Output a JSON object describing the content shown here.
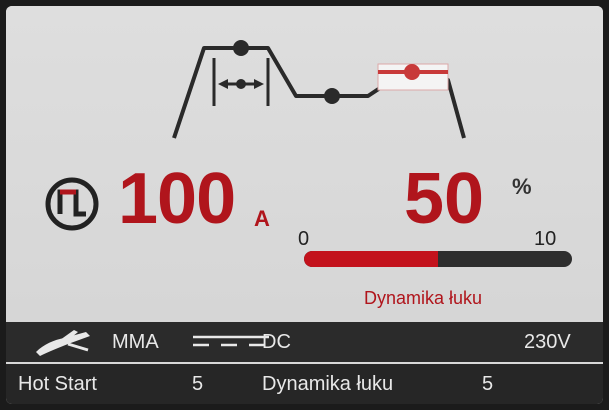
{
  "current": {
    "value": "100",
    "unit": "A"
  },
  "arc_dynamics": {
    "value": "50",
    "unit": "%",
    "scale_min": "0",
    "scale_max": "10",
    "level_fraction": 0.5,
    "caption": "Dynamika łuku"
  },
  "status_bar": {
    "mode": "MMA",
    "current_type": "DC",
    "voltage": "230V"
  },
  "footer": {
    "param1_label": "Hot Start",
    "param1_value": "5",
    "param2_label": "Dynamika łuku",
    "param2_value": "5"
  },
  "colors": {
    "accent_red": "#b0151c",
    "bar_track": "#2e2e2e",
    "screen_bg": "#d8d8d8"
  },
  "icons": [
    "waveform-diagram-icon",
    "pulse-mode-icon",
    "electrode-holder-icon",
    "dc-symbol-icon"
  ]
}
